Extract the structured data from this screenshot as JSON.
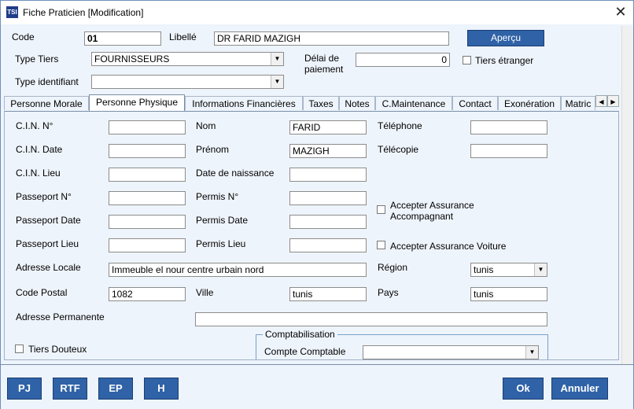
{
  "window": {
    "title": "Fiche Praticien [Modification]",
    "app_icon_text": "TSI",
    "close_glyph": "✕"
  },
  "header": {
    "code_label": "Code",
    "code_value": "01",
    "libelle_label": "Libellé",
    "libelle_value": "DR FARID MAZIGH",
    "apercu_button": "Aperçu",
    "type_tiers_label": "Type Tiers",
    "type_tiers_value": "FOURNISSEURS",
    "delai_label_1": "Délai de",
    "delai_label_2": "paiement",
    "delai_value": "0",
    "tiers_etranger_label": "Tiers étranger",
    "type_identifiant_label": "Type identifiant",
    "type_identifiant_value": ""
  },
  "tabs": [
    {
      "label": "Personne Morale"
    },
    {
      "label": "Personne Physique"
    },
    {
      "label": "Informations Financières"
    },
    {
      "label": "Taxes"
    },
    {
      "label": "Notes"
    },
    {
      "label": "C.Maintenance"
    },
    {
      "label": "Contact"
    },
    {
      "label": "Exonération"
    },
    {
      "label": "Matric"
    }
  ],
  "form": {
    "cin_no_label": "C.I.N. N°",
    "cin_no_value": "",
    "cin_date_label": "C.I.N. Date",
    "cin_date_value": "",
    "cin_lieu_label": "C.I.N. Lieu",
    "cin_lieu_value": "",
    "passeport_no_label": "Passeport N°",
    "passeport_no_value": "",
    "passeport_date_label": "Passeport Date",
    "passeport_date_value": "",
    "passeport_lieu_label": "Passeport Lieu",
    "passeport_lieu_value": "",
    "nom_label": "Nom",
    "nom_value": "FARID",
    "prenom_label": "Prénom",
    "prenom_value": "MAZIGH",
    "date_naissance_label": "Date de naissance",
    "date_naissance_value": "",
    "permis_no_label": "Permis N°",
    "permis_no_value": "",
    "permis_date_label": "Permis Date",
    "permis_date_value": "",
    "permis_lieu_label": "Permis Lieu",
    "permis_lieu_value": "",
    "telephone_label": "Téléphone",
    "telephone_value": "",
    "telecopie_label": "Télécopie",
    "telecopie_value": "",
    "accepter_assurance_accomp_1": "Accepter Assurance",
    "accepter_assurance_accomp_2": "Accompagnant",
    "accepter_assurance_voiture": "Accepter Assurance Voiture",
    "adresse_locale_label": "Adresse Locale",
    "adresse_locale_value": "Immeuble el nour centre urbain nord",
    "region_label": "Région",
    "region_value": "tunis",
    "code_postal_label": "Code Postal",
    "code_postal_value": "1082",
    "ville_label": "Ville",
    "ville_value": "tunis",
    "pays_label": "Pays",
    "pays_value": "tunis",
    "adresse_permanente_label": "Adresse Permanente",
    "adresse_permanente_value": "",
    "tiers_douteux_label": "Tiers Douteux",
    "comptabilisation_title": "Comptabilisation",
    "compte_comptable_label": "Compte Comptable",
    "compte_comptable_value": ""
  },
  "footer": {
    "pj": "PJ",
    "rtf": "RTF",
    "ep": "EP",
    "h": "H",
    "ok": "Ok",
    "annuler": "Annuler"
  },
  "colors": {
    "accent_button": "#2f62a6",
    "background": "#eef4fb"
  }
}
